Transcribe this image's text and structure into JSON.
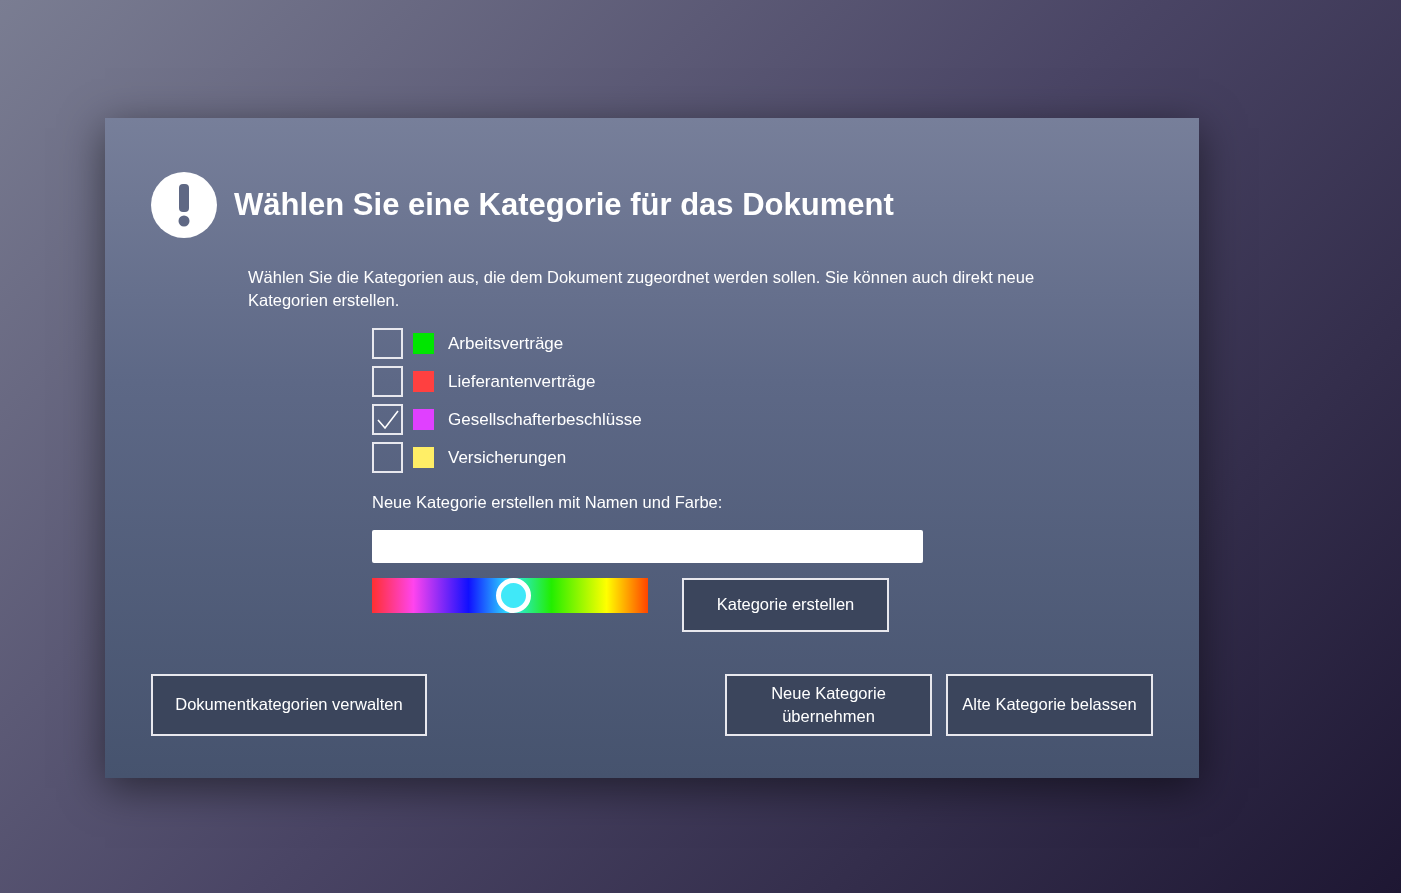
{
  "dialog": {
    "title": "Wählen Sie eine Kategorie für das Dokument",
    "description": "Wählen Sie die Kategorien aus, die dem Dokument zugeordnet werden sollen. Sie können auch direkt neue Kategorien erstellen.",
    "categories": [
      {
        "label": "Arbeitsverträge",
        "checked": false,
        "color": "#00e600"
      },
      {
        "label": "Lieferantenverträge",
        "checked": false,
        "color": "#ff4040"
      },
      {
        "label": "Gesellschafterbeschlüsse",
        "checked": true,
        "color": "#e040ff"
      },
      {
        "label": "Versicherungen",
        "checked": false,
        "color": "#ffee66"
      }
    ],
    "new_category_label": "Neue Kategorie erstellen mit Namen und Farbe:",
    "hue_slider": {
      "level": 0.51
    },
    "create_button": "Kategorie erstellen",
    "buttons": [
      {
        "label": "Dokumentkategorien verwalten"
      },
      {
        "label": "Neue Kategorie übernehmen"
      },
      {
        "label": "Alte Kategorie belassen"
      }
    ]
  }
}
